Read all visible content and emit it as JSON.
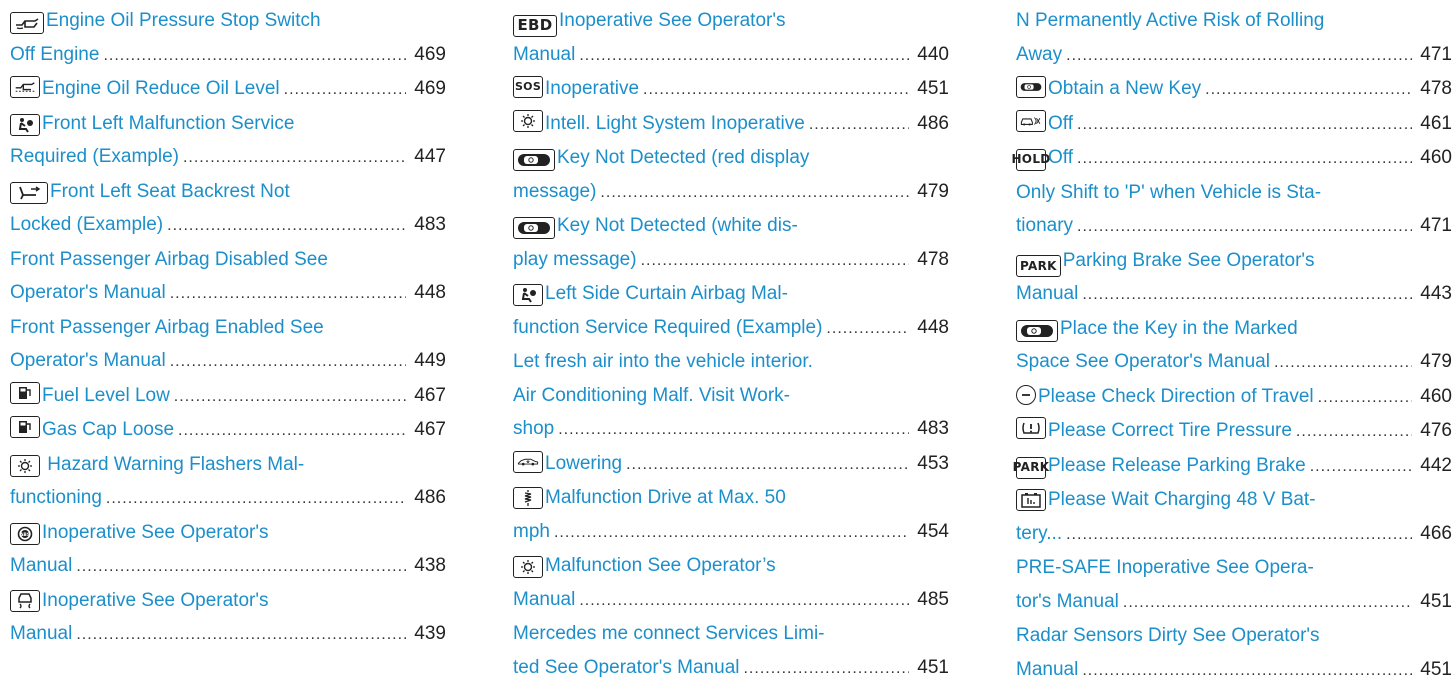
{
  "columns": [
    [
      {
        "icon": "oil-pressure-icon",
        "lines": [
          "Engine Oil Pressure Stop Switch"
        ],
        "tail": "Off Engine",
        "page": "469"
      },
      {
        "icon": "oil-level-icon",
        "lines": [],
        "tail": "Engine Oil Reduce Oil Level",
        "page": "469"
      },
      {
        "icon": "airbag-icon",
        "lines": [
          "Front Left Malfunction Service"
        ],
        "tail": "Required (Example)",
        "page": "447"
      },
      {
        "icon": "seat-backrest-icon",
        "lines": [
          "Front Left Seat Backrest Not"
        ],
        "tail": "Locked (Example)",
        "page": "483"
      },
      {
        "icon": "",
        "lines": [
          "Front Passenger Airbag Disabled See"
        ],
        "tail": "Operator's Manual",
        "page": "448"
      },
      {
        "icon": "",
        "lines": [
          "Front Passenger Airbag Enabled See"
        ],
        "tail": "Operator's Manual",
        "page": "449"
      },
      {
        "icon": "fuel-pump-icon",
        "lines": [],
        "tail": "Fuel Level Low",
        "page": "467"
      },
      {
        "icon": "fuel-pump-icon",
        "lines": [],
        "tail": "Gas Cap Loose",
        "page": "467"
      },
      {
        "icon": "light-bulb-icon",
        "lines": [
          " Hazard Warning Flashers Mal-"
        ],
        "tail": "functioning",
        "page": "486"
      },
      {
        "icon": "abs-icon",
        "lines": [
          "Inoperative See Operator's"
        ],
        "tail": "Manual",
        "page": "438"
      },
      {
        "icon": "skid-car-icon",
        "lines": [
          "Inoperative See Operator's"
        ],
        "tail": "Manual",
        "page": "439"
      }
    ],
    [
      {
        "icon": "ebd-icon",
        "icon_text": "EBD",
        "lines": [
          "Inoperative See Operator's"
        ],
        "tail": "Manual",
        "page": "440"
      },
      {
        "icon": "sos-call-icon",
        "icon_text": "SOS",
        "lines": [],
        "tail": "Inoperative",
        "page": "451"
      },
      {
        "icon": "light-bulb-icon",
        "lines": [],
        "tail": "Intell. Light System Inoperative",
        "page": "486"
      },
      {
        "icon": "key-icon",
        "lines": [
          "Key Not Detected   (red display"
        ],
        "tail": "message)",
        "page": "479"
      },
      {
        "icon": "key-icon",
        "lines": [
          "Key Not Detected   (white dis-"
        ],
        "tail": "play message)",
        "page": "478"
      },
      {
        "icon": "airbag-icon",
        "lines": [
          "Left Side Curtain Airbag Mal-"
        ],
        "tail": "function Service Required (Example)",
        "page": "448"
      },
      {
        "icon": "",
        "lines": [
          "Let fresh air into the vehicle interior.",
          "Air Conditioning Malf. Visit Work-"
        ],
        "tail": "shop",
        "page": "483"
      },
      {
        "icon": "lowering-car-icon",
        "lines": [],
        "tail": "Lowering",
        "page": "453"
      },
      {
        "icon": "suspension-icon",
        "lines": [
          "Malfunction Drive at Max. 50"
        ],
        "tail": "mph",
        "page": "454"
      },
      {
        "icon": "light-bulb-icon",
        "lines": [
          "Malfunction See Operator’s"
        ],
        "tail": "Manual",
        "page": "485"
      },
      {
        "icon": "",
        "lines": [
          "Mercedes me connect Services Limi-"
        ],
        "tail": "ted See Operator's Manual",
        "page": "451"
      }
    ],
    [
      {
        "icon": "",
        "lines": [
          "N Permanently Active Risk of Rolling"
        ],
        "tail": "Away",
        "page": "471"
      },
      {
        "icon": "key-icon",
        "lines": [],
        "tail": "Obtain a New Key",
        "page": "478"
      },
      {
        "icon": "car-off-icon",
        "lines": [],
        "tail": "Off",
        "page": "461"
      },
      {
        "icon": "hold-icon",
        "icon_text": "HOLD",
        "lines": [],
        "tail": "Off",
        "page": "460"
      },
      {
        "icon": "",
        "lines": [
          "Only Shift to 'P' when Vehicle is Sta-"
        ],
        "tail": "tionary",
        "page": "471"
      },
      {
        "icon": "park-icon",
        "icon_text": "PARK",
        "lines": [
          "Parking Brake See Operator's"
        ],
        "tail": "Manual",
        "page": "443"
      },
      {
        "icon": "key-icon",
        "lines": [
          "Place the Key in the Marked"
        ],
        "tail": "Space See Operator's Manual",
        "page": "479"
      },
      {
        "icon": "direction-icon",
        "lines": [],
        "tail": "Please Check Direction of Travel",
        "page": "460"
      },
      {
        "icon": "tire-pressure-icon",
        "lines": [],
        "tail": "Please Correct Tire Pressure",
        "page": "476"
      },
      {
        "icon": "park-icon",
        "icon_text": "PARK",
        "lines": [],
        "tail": "Please Release Parking Brake",
        "page": "442"
      },
      {
        "icon": "battery-icon",
        "lines": [
          "Please Wait Charging 48 V Bat-"
        ],
        "tail": "tery...",
        "page": "466"
      },
      {
        "icon": "",
        "lines": [
          "PRE-SAFE Inoperative See Opera-"
        ],
        "tail": "tor's Manual",
        "page": "451"
      },
      {
        "icon": "",
        "lines": [
          "Radar Sensors Dirty See Operator's"
        ],
        "tail": "Manual",
        "page": "451"
      }
    ]
  ]
}
